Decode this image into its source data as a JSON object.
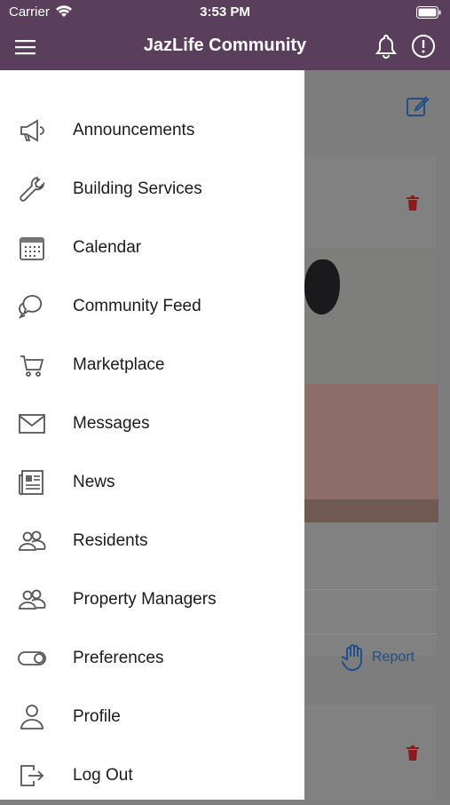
{
  "status_bar": {
    "carrier": "Carrier",
    "time": "3:53 PM"
  },
  "header": {
    "title": "JazLife Community"
  },
  "menu": {
    "items": [
      {
        "label": "Announcements",
        "icon": "megaphone-icon"
      },
      {
        "label": "Building Services",
        "icon": "wrench-icon"
      },
      {
        "label": "Calendar",
        "icon": "calendar-icon"
      },
      {
        "label": "Community Feed",
        "icon": "chat-bubbles-icon"
      },
      {
        "label": "Marketplace",
        "icon": "cart-icon"
      },
      {
        "label": "Messages",
        "icon": "envelope-icon"
      },
      {
        "label": "News",
        "icon": "newspaper-icon"
      },
      {
        "label": "Residents",
        "icon": "people-icon"
      },
      {
        "label": "Property Managers",
        "icon": "people-icon"
      },
      {
        "label": "Preferences",
        "icon": "toggle-icon"
      },
      {
        "label": "Profile",
        "icon": "person-icon"
      },
      {
        "label": "Log Out",
        "icon": "logout-icon"
      }
    ]
  },
  "feed": {
    "report_label": "Report"
  },
  "colors": {
    "header_bg": "#5a3f5c",
    "link_blue": "#1f4f86",
    "delete_red": "#8b1a1a"
  }
}
